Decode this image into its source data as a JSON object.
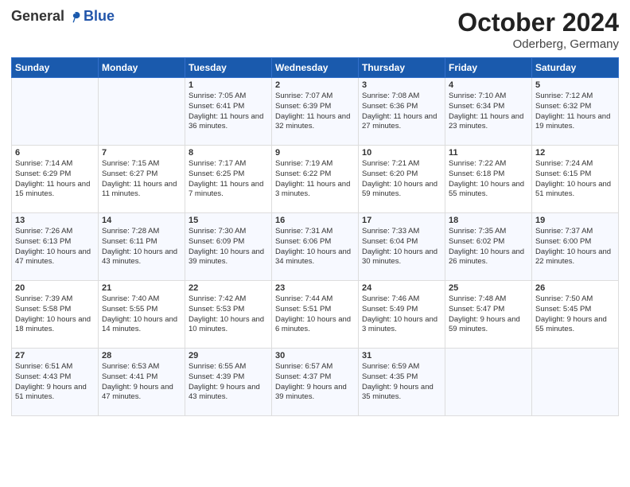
{
  "header": {
    "logo_general": "General",
    "logo_blue": "Blue",
    "month": "October 2024",
    "location": "Oderberg, Germany"
  },
  "days_of_week": [
    "Sunday",
    "Monday",
    "Tuesday",
    "Wednesday",
    "Thursday",
    "Friday",
    "Saturday"
  ],
  "weeks": [
    [
      {
        "day": "",
        "detail": ""
      },
      {
        "day": "",
        "detail": ""
      },
      {
        "day": "1",
        "detail": "Sunrise: 7:05 AM\nSunset: 6:41 PM\nDaylight: 11 hours and 36 minutes."
      },
      {
        "day": "2",
        "detail": "Sunrise: 7:07 AM\nSunset: 6:39 PM\nDaylight: 11 hours and 32 minutes."
      },
      {
        "day": "3",
        "detail": "Sunrise: 7:08 AM\nSunset: 6:36 PM\nDaylight: 11 hours and 27 minutes."
      },
      {
        "day": "4",
        "detail": "Sunrise: 7:10 AM\nSunset: 6:34 PM\nDaylight: 11 hours and 23 minutes."
      },
      {
        "day": "5",
        "detail": "Sunrise: 7:12 AM\nSunset: 6:32 PM\nDaylight: 11 hours and 19 minutes."
      }
    ],
    [
      {
        "day": "6",
        "detail": "Sunrise: 7:14 AM\nSunset: 6:29 PM\nDaylight: 11 hours and 15 minutes."
      },
      {
        "day": "7",
        "detail": "Sunrise: 7:15 AM\nSunset: 6:27 PM\nDaylight: 11 hours and 11 minutes."
      },
      {
        "day": "8",
        "detail": "Sunrise: 7:17 AM\nSunset: 6:25 PM\nDaylight: 11 hours and 7 minutes."
      },
      {
        "day": "9",
        "detail": "Sunrise: 7:19 AM\nSunset: 6:22 PM\nDaylight: 11 hours and 3 minutes."
      },
      {
        "day": "10",
        "detail": "Sunrise: 7:21 AM\nSunset: 6:20 PM\nDaylight: 10 hours and 59 minutes."
      },
      {
        "day": "11",
        "detail": "Sunrise: 7:22 AM\nSunset: 6:18 PM\nDaylight: 10 hours and 55 minutes."
      },
      {
        "day": "12",
        "detail": "Sunrise: 7:24 AM\nSunset: 6:15 PM\nDaylight: 10 hours and 51 minutes."
      }
    ],
    [
      {
        "day": "13",
        "detail": "Sunrise: 7:26 AM\nSunset: 6:13 PM\nDaylight: 10 hours and 47 minutes."
      },
      {
        "day": "14",
        "detail": "Sunrise: 7:28 AM\nSunset: 6:11 PM\nDaylight: 10 hours and 43 minutes."
      },
      {
        "day": "15",
        "detail": "Sunrise: 7:30 AM\nSunset: 6:09 PM\nDaylight: 10 hours and 39 minutes."
      },
      {
        "day": "16",
        "detail": "Sunrise: 7:31 AM\nSunset: 6:06 PM\nDaylight: 10 hours and 34 minutes."
      },
      {
        "day": "17",
        "detail": "Sunrise: 7:33 AM\nSunset: 6:04 PM\nDaylight: 10 hours and 30 minutes."
      },
      {
        "day": "18",
        "detail": "Sunrise: 7:35 AM\nSunset: 6:02 PM\nDaylight: 10 hours and 26 minutes."
      },
      {
        "day": "19",
        "detail": "Sunrise: 7:37 AM\nSunset: 6:00 PM\nDaylight: 10 hours and 22 minutes."
      }
    ],
    [
      {
        "day": "20",
        "detail": "Sunrise: 7:39 AM\nSunset: 5:58 PM\nDaylight: 10 hours and 18 minutes."
      },
      {
        "day": "21",
        "detail": "Sunrise: 7:40 AM\nSunset: 5:55 PM\nDaylight: 10 hours and 14 minutes."
      },
      {
        "day": "22",
        "detail": "Sunrise: 7:42 AM\nSunset: 5:53 PM\nDaylight: 10 hours and 10 minutes."
      },
      {
        "day": "23",
        "detail": "Sunrise: 7:44 AM\nSunset: 5:51 PM\nDaylight: 10 hours and 6 minutes."
      },
      {
        "day": "24",
        "detail": "Sunrise: 7:46 AM\nSunset: 5:49 PM\nDaylight: 10 hours and 3 minutes."
      },
      {
        "day": "25",
        "detail": "Sunrise: 7:48 AM\nSunset: 5:47 PM\nDaylight: 9 hours and 59 minutes."
      },
      {
        "day": "26",
        "detail": "Sunrise: 7:50 AM\nSunset: 5:45 PM\nDaylight: 9 hours and 55 minutes."
      }
    ],
    [
      {
        "day": "27",
        "detail": "Sunrise: 6:51 AM\nSunset: 4:43 PM\nDaylight: 9 hours and 51 minutes."
      },
      {
        "day": "28",
        "detail": "Sunrise: 6:53 AM\nSunset: 4:41 PM\nDaylight: 9 hours and 47 minutes."
      },
      {
        "day": "29",
        "detail": "Sunrise: 6:55 AM\nSunset: 4:39 PM\nDaylight: 9 hours and 43 minutes."
      },
      {
        "day": "30",
        "detail": "Sunrise: 6:57 AM\nSunset: 4:37 PM\nDaylight: 9 hours and 39 minutes."
      },
      {
        "day": "31",
        "detail": "Sunrise: 6:59 AM\nSunset: 4:35 PM\nDaylight: 9 hours and 35 minutes."
      },
      {
        "day": "",
        "detail": ""
      },
      {
        "day": "",
        "detail": ""
      }
    ]
  ]
}
